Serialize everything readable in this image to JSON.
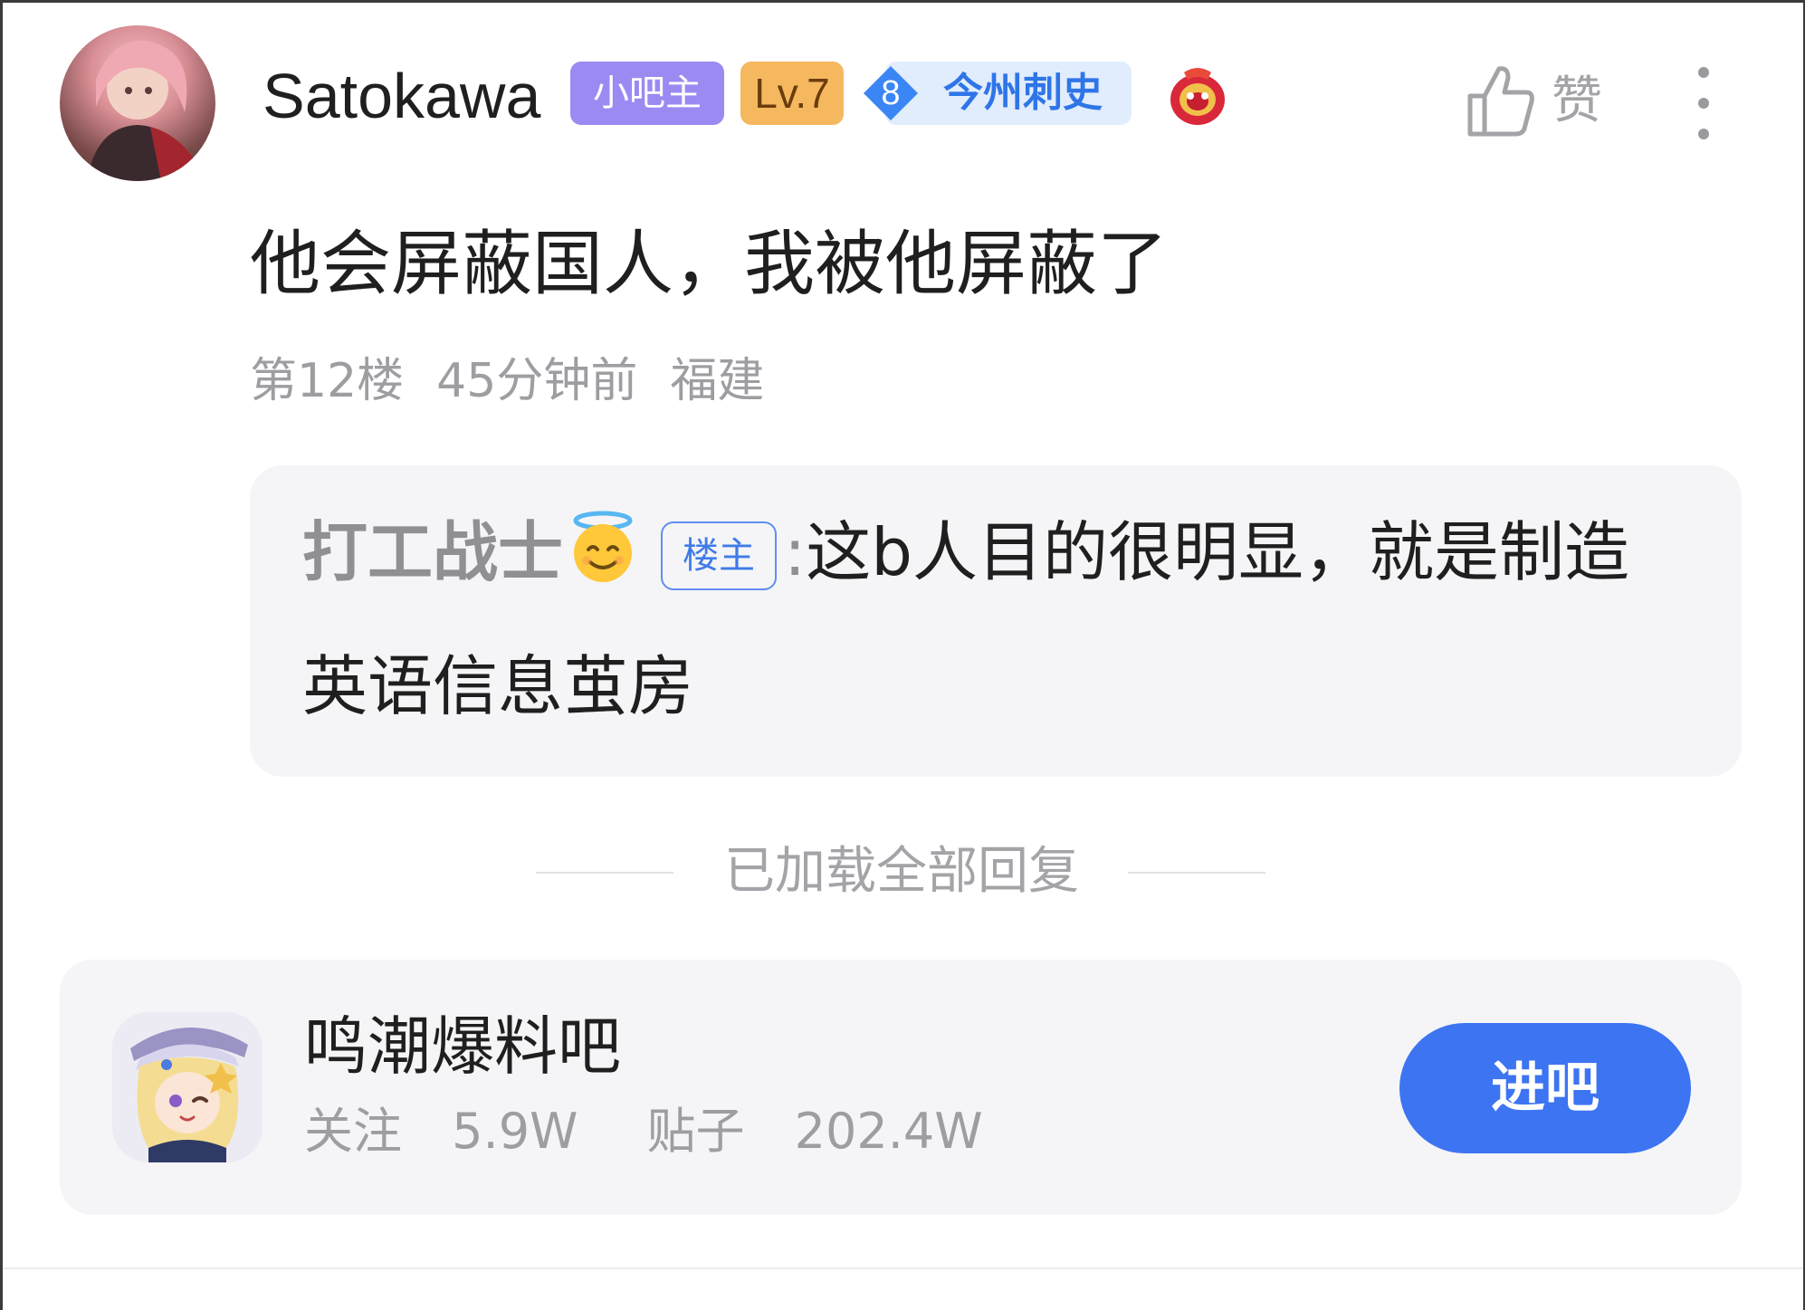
{
  "post": {
    "user": {
      "name": "Satokawa",
      "badge_admin": "小吧主",
      "badge_level": "Lv.7",
      "title_level": "8",
      "title": "今州刺史",
      "avatar_icon": "user-avatar",
      "decor_icon": "festive-lion-badge-icon"
    },
    "like_label": "赞",
    "text": "他会屏蔽国人，我被他屏蔽了",
    "meta": {
      "floor": "第12楼",
      "time": "45分钟前",
      "location": "福建"
    },
    "quote": {
      "author": "打工战士",
      "emoji": "smiling-face-with-halo",
      "op_badge": "楼主",
      "colon": ":",
      "content_line1": "这b人目的很明显，就是制造",
      "content_line2": "英语信息茧房"
    }
  },
  "loaded_all": "已加载全部回复",
  "forum": {
    "name": "鸣潮爆料吧",
    "follow_label": "关注",
    "follow_count": "5.9W",
    "posts_label": "贴子",
    "posts_count": "202.4W",
    "enter_label": "进吧"
  },
  "colors": {
    "accent_blue": "#3d74f2",
    "admin_badge": "#9b8af2",
    "level_badge": "#f5b85f",
    "title_badge_bg": "#e1edfd",
    "muted_text": "#9d9da2"
  }
}
